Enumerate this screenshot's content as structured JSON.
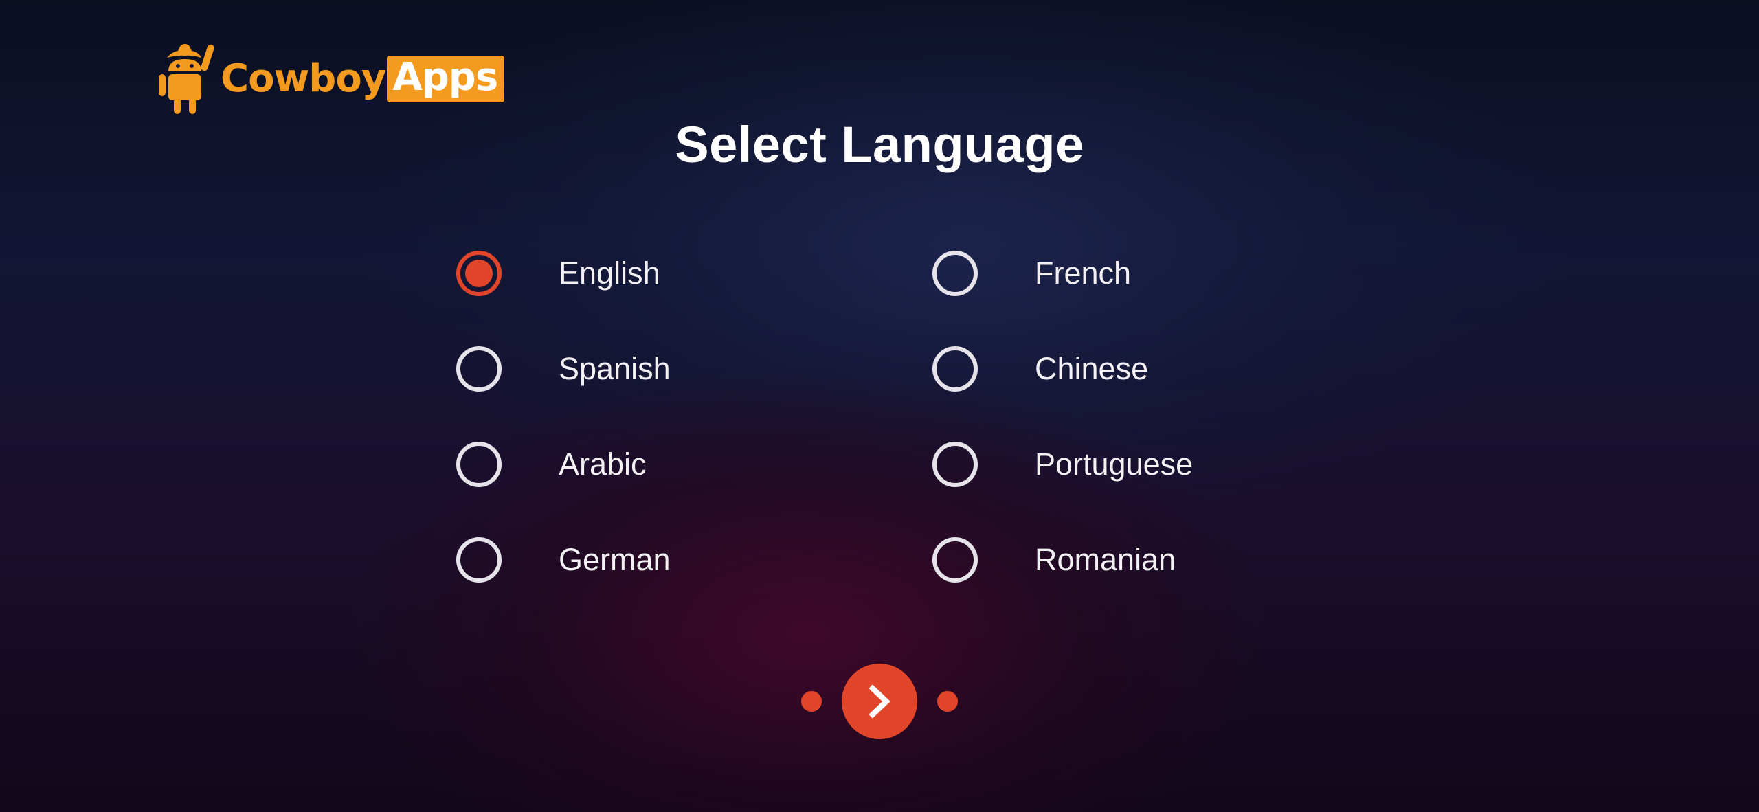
{
  "brand": {
    "logo_text_part1": "Cowboy",
    "logo_text_part2": "Apps",
    "logo_icon": "android-cowboy-icon",
    "brand_color": "#f39a1f"
  },
  "title": "Select Language",
  "languages": {
    "left": [
      {
        "label": "English",
        "selected": true
      },
      {
        "label": "Spanish",
        "selected": false
      },
      {
        "label": "Arabic",
        "selected": false
      },
      {
        "label": "German",
        "selected": false
      }
    ],
    "right": [
      {
        "label": "French",
        "selected": false
      },
      {
        "label": "Chinese",
        "selected": false
      },
      {
        "label": "Portuguese",
        "selected": false
      },
      {
        "label": "Romanian",
        "selected": false
      }
    ]
  },
  "navigation": {
    "next_icon": "chevron-right-icon",
    "page_dots": 2
  },
  "colors": {
    "accent": "#e2462a",
    "radio_border": "#e6e3ea",
    "text": "#f3f1f3"
  }
}
